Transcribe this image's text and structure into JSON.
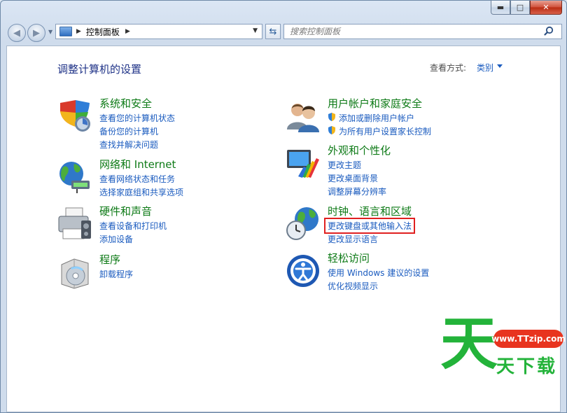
{
  "window": {
    "minimize": "▬",
    "maximize": "□",
    "close": "✕"
  },
  "nav": {
    "breadcrumb": "控制面板",
    "search_placeholder": "搜索控制面板"
  },
  "page": {
    "title": "调整计算机的设置",
    "view_by_label": "查看方式:",
    "view_by_value": "类别"
  },
  "categories": {
    "system_security": {
      "title": "系统和安全",
      "links": [
        "查看您的计算机状态",
        "备份您的计算机",
        "查找并解决问题"
      ]
    },
    "network": {
      "title": "网络和 Internet",
      "links": [
        "查看网络状态和任务",
        "选择家庭组和共享选项"
      ]
    },
    "hardware": {
      "title": "硬件和声音",
      "links": [
        "查看设备和打印机",
        "添加设备"
      ]
    },
    "programs": {
      "title": "程序",
      "links": [
        "卸载程序"
      ]
    },
    "user_accounts": {
      "title": "用户帐户和家庭安全",
      "links": [
        "添加或删除用户帐户",
        "为所有用户设置家长控制"
      ]
    },
    "appearance": {
      "title": "外观和个性化",
      "links": [
        "更改主题",
        "更改桌面背景",
        "调整屏幕分辨率"
      ]
    },
    "clock_region": {
      "title": "时钟、语言和区域",
      "links": [
        "更改键盘或其他输入法",
        "更改显示语言"
      ]
    },
    "ease": {
      "title": "轻松访问",
      "links": [
        "使用 Windows 建议的设置",
        "优化视频显示"
      ]
    }
  },
  "watermark": {
    "big_char": "天",
    "badge": "www.TTzip.com",
    "text": "天下载"
  },
  "colors": {
    "category_title": "#0d7a16",
    "link": "#1a5bbf",
    "highlight_box": "#e02020"
  }
}
